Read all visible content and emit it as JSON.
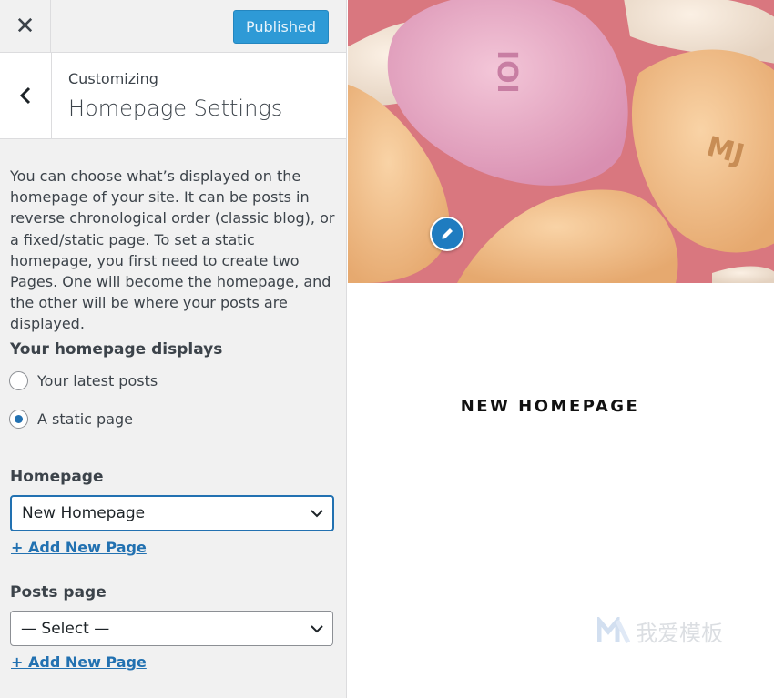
{
  "topbar": {
    "close_icon": "close-icon",
    "publish_label": "Published"
  },
  "header": {
    "breadcrumb": "Customizing",
    "title": "Homepage Settings"
  },
  "description": "You can choose what’s displayed on the homepage of your site. It can be posts in reverse chronological order (classic blog), or a fixed/static page. To set a static homepage, you first need to create two Pages. One will become the homepage, and the other will be where your posts are displayed.",
  "homepage_displays": {
    "label": "Your homepage displays",
    "options": [
      {
        "label": "Your latest posts",
        "checked": false
      },
      {
        "label": "A static page",
        "checked": true
      }
    ]
  },
  "homepage": {
    "label": "Homepage",
    "selected": "New Homepage",
    "add_link": "+ Add New Page"
  },
  "posts_page": {
    "label": "Posts page",
    "selected": "— Select —",
    "add_link": "+ Add New Page"
  },
  "preview": {
    "heading": "NEW HOMEPAGE",
    "watermark": "我爱模板"
  },
  "colors": {
    "accent": "#2271b1",
    "publish": "#2e9ad6",
    "sidebar_bg": "#f1f1f1"
  }
}
